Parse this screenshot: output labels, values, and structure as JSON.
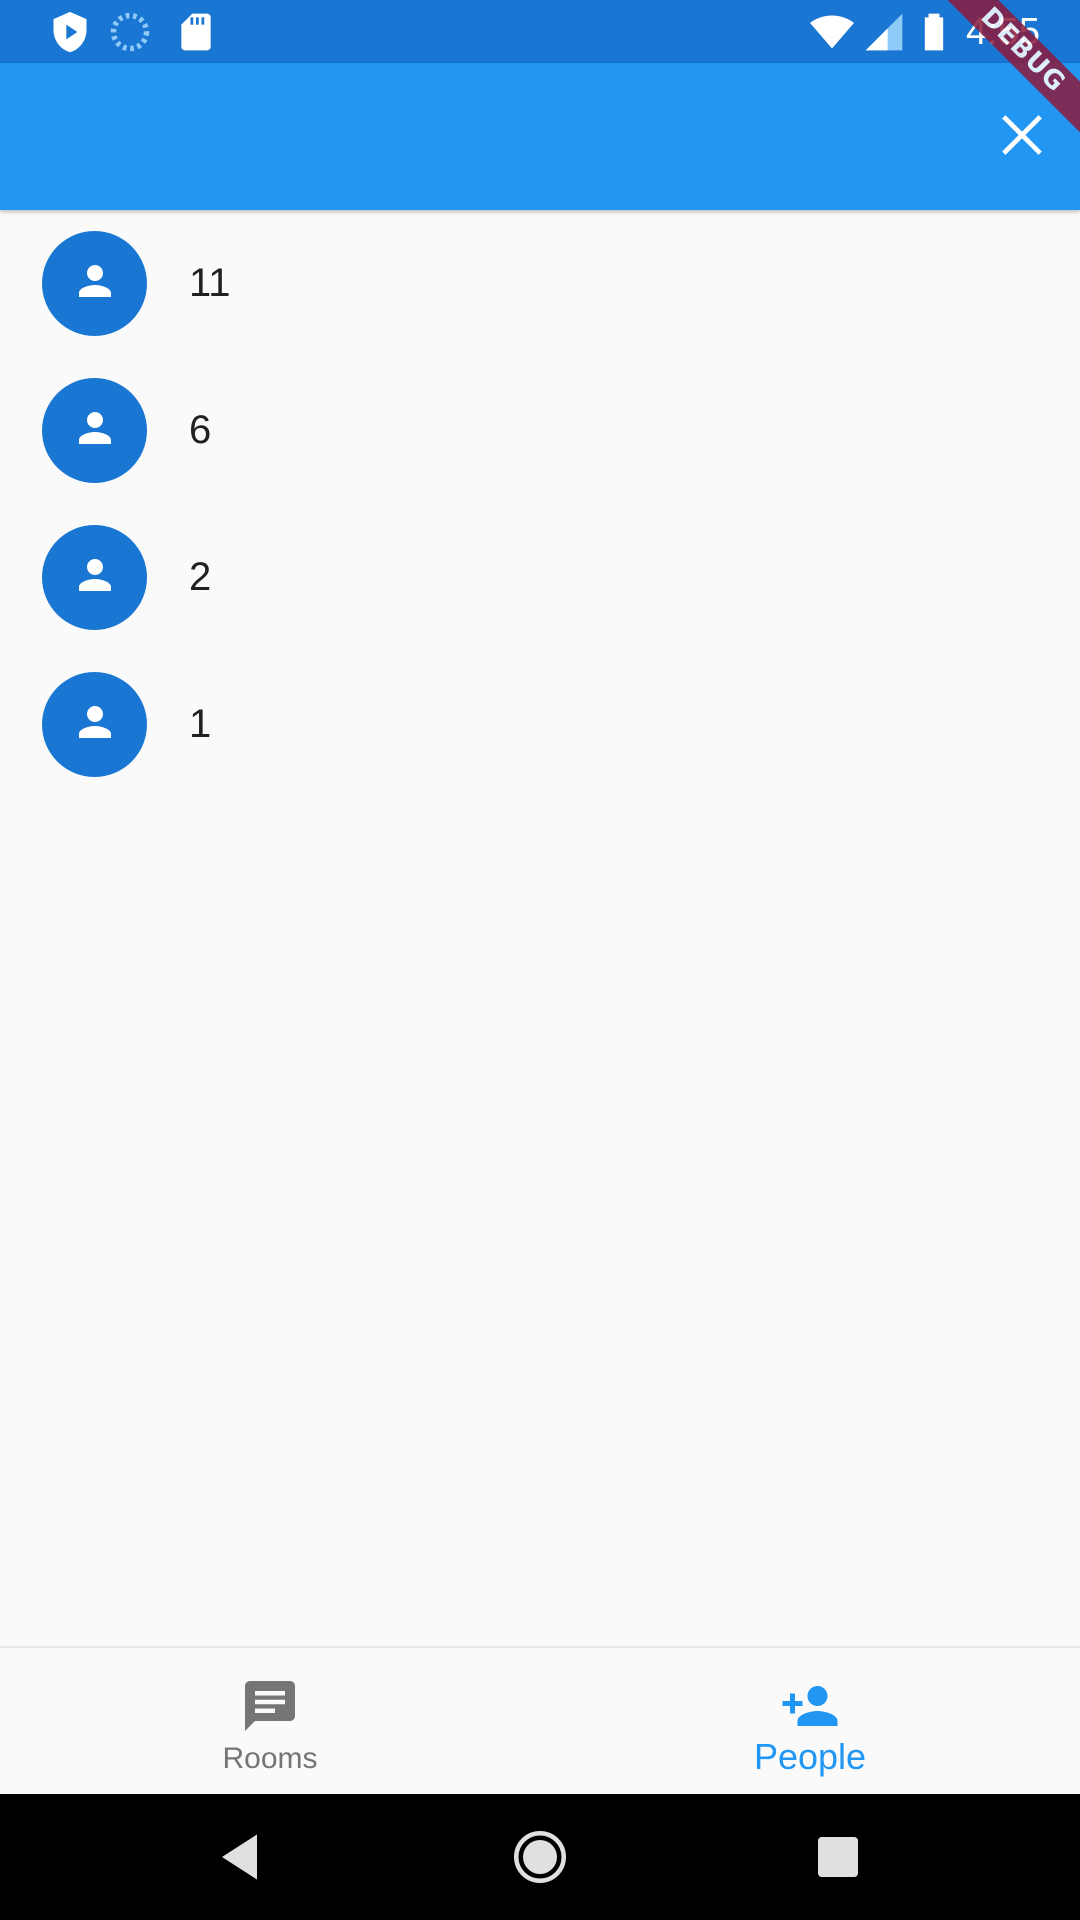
{
  "status_bar": {
    "time": "4:55",
    "icons": [
      "play-protect-icon",
      "sync-icon",
      "sd-card-icon",
      "wifi-icon",
      "signal-icon",
      "battery-icon"
    ]
  },
  "app_bar": {
    "close_icon": "close-icon",
    "debug_banner": "DEBUG",
    "color": "#2196f3"
  },
  "people_list": [
    {
      "label": "11",
      "icon": "person-icon"
    },
    {
      "label": "6",
      "icon": "person-icon"
    },
    {
      "label": "2",
      "icon": "person-icon"
    },
    {
      "label": "1",
      "icon": "person-icon"
    }
  ],
  "bottom_nav": {
    "items": [
      {
        "label": "Rooms",
        "icon": "chat-icon",
        "active": false
      },
      {
        "label": "People",
        "icon": "person-add-icon",
        "active": true
      }
    ],
    "active_color": "#2196f3",
    "inactive_color": "#757575"
  },
  "system_nav": {
    "icons": [
      "back-icon",
      "home-icon",
      "recents-icon"
    ]
  },
  "colors": {
    "status_bar": "#1976d2",
    "avatar": "#1976d2",
    "background": "#fafafa"
  }
}
